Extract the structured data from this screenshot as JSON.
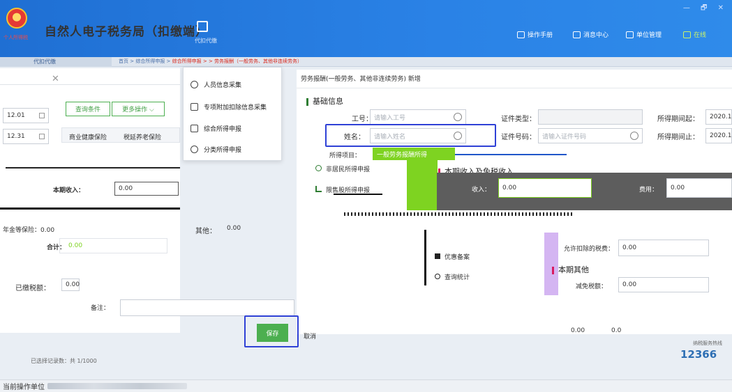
{
  "titlebar": {
    "emblem_caption": "个人所得税",
    "app_title": "自然人电子税务局（扣缴端）",
    "agent_label": "代扣代缴",
    "nav": {
      "manual": "操作手册",
      "messages": "消息中心",
      "unit_admin": "单位管理",
      "online": "在线"
    },
    "window_controls": "— 🗗 ✕"
  },
  "tabs": {
    "active_tab": "代扣代缴",
    "breadcrumb_prefix": "首页 > 综合所得申报 > ",
    "breadcrumb_tail": "综合所得申报 > > 劳务报酬（一般劳务、其他非连续劳务）"
  },
  "left_panel": {
    "close": "✕",
    "date_from": "12.01",
    "date_to": "12.31",
    "filter_button": "查询条件",
    "more_button": "更多操作 ⌵",
    "col_health": "商业健康保险",
    "col_pension": "税延养老保险",
    "income_label": "本期收入：",
    "income_value": "0.00",
    "insurance_label": "年金等保险：0.00",
    "other_label": "其他：",
    "other_value": "0.00",
    "total_label": "合计：",
    "total_value": "0.00",
    "paid_label": "已缴税额：",
    "paid_value": "0.00",
    "remark_label": "备注：",
    "footer_note": "已选择记录数：共 1/1000"
  },
  "menu": {
    "items": [
      {
        "label": "人员信息采集",
        "icon": "person-icon"
      },
      {
        "label": "专项附加扣除信息采集",
        "icon": "list-icon"
      },
      {
        "label": "综合所得申报",
        "icon": "layers-icon"
      },
      {
        "label": "分类所得申报",
        "icon": "clock-icon"
      }
    ],
    "extra_1": "非居民所得申报",
    "extra_2": "限售股所得申报",
    "extra_3": "优惠备案",
    "extra_4": "查询统计"
  },
  "dialog": {
    "title": "劳务报酬(一般劳务、其他非连续劳务) 新增",
    "section_basic": "基础信息",
    "work_no_label": "工号：",
    "work_no_placeholder": "请输入工号",
    "cert_type_label": "证件类型：",
    "period_start_label": "所得期间起：",
    "period_start_value": "2020.1",
    "name_label": "姓名：",
    "name_placeholder": "请输入姓名",
    "cert_no_label": "证件号码：",
    "cert_no_placeholder": "请输入证件号码",
    "period_end_label": "所得期间止：",
    "period_end_value": "2020.1",
    "income_item_label": "所得项目：",
    "income_item_value": "一般劳务报酬所得",
    "section_income": "本期收入及免税收入",
    "income_label": "收入：",
    "income_value": "0.00",
    "expense_label": "费用：",
    "expense_value": "0.00",
    "allow_deduct_label": "允许扣除的税费：",
    "allow_deduct_value": "0.00",
    "section_other": "本期其他",
    "relief_label": "减免税额：",
    "relief_value": "0.00",
    "table_v1": "0.00",
    "table_v2": "0.0",
    "save_button": "保存",
    "cancel_button": "取消"
  },
  "footer": {
    "current_unit_label": "当前操作单位",
    "hotline_caption": "纳税服务热线",
    "hotline_number": "12366"
  },
  "colors": {
    "title_blue": "#1f6fd3",
    "accent_green": "#4caf50",
    "highlight_blue": "#2f41d6",
    "required_red": "#e53935"
  }
}
